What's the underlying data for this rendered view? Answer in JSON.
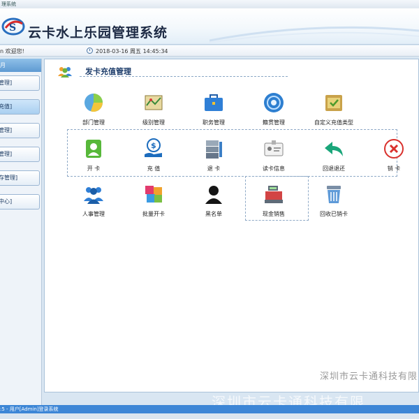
{
  "window": {
    "title": "理系统"
  },
  "header": {
    "app_title": "云卡水上乐园管理系统"
  },
  "infobar": {
    "welcome": "n 欢迎您!",
    "datetime": "2018-03-16  周五  14:45:34"
  },
  "sidebar": {
    "heading": "月",
    "items": [
      {
        "label": "管理]"
      },
      {
        "label": "充值]"
      },
      {
        "label": "管理]"
      },
      {
        "label": "管理]"
      },
      {
        "label": "存管理]"
      },
      {
        "label": "中心]"
      }
    ]
  },
  "main": {
    "section_title": "发卡充值管理",
    "tiles": [
      {
        "label": "部门管理",
        "icon": "department-pie-icon"
      },
      {
        "label": "级别管理",
        "icon": "level-map-icon"
      },
      {
        "label": "职务管理",
        "icon": "briefcase-icon"
      },
      {
        "label": "籍贯管理",
        "icon": "location-disc-icon"
      },
      {
        "label": "自定义充值类型",
        "icon": "custom-folder-icon"
      },
      {
        "label": "开  卡",
        "icon": "open-card-icon"
      },
      {
        "label": "充  值",
        "icon": "recharge-coin-icon"
      },
      {
        "label": "退  卡",
        "icon": "return-card-icon"
      },
      {
        "label": "读卡信息",
        "icon": "id-card-icon"
      },
      {
        "label": "回退退还",
        "icon": "undo-arrow-icon"
      },
      {
        "label": "销  卡",
        "icon": "cancel-x-icon"
      },
      {
        "label": "人事管理",
        "icon": "people-icon"
      },
      {
        "label": "批量开卡",
        "icon": "batch-cards-icon"
      },
      {
        "label": "黑名单",
        "icon": "blacklist-person-icon"
      },
      {
        "label": "现金销售",
        "icon": "cash-register-icon"
      },
      {
        "label": "回收已销卡",
        "icon": "recycle-bin-icon"
      }
    ]
  },
  "watermark": {
    "text": "深圳市云卡通科技有限",
    "overlay": "深圳市云卡通科技有限"
  },
  "statusbar": {
    "text": ":5 - 用户[Admin]登录系统"
  },
  "colors": {
    "accent": "#3d86d6",
    "title": "#1d3d6b",
    "dashed": "#8ea9c6"
  }
}
